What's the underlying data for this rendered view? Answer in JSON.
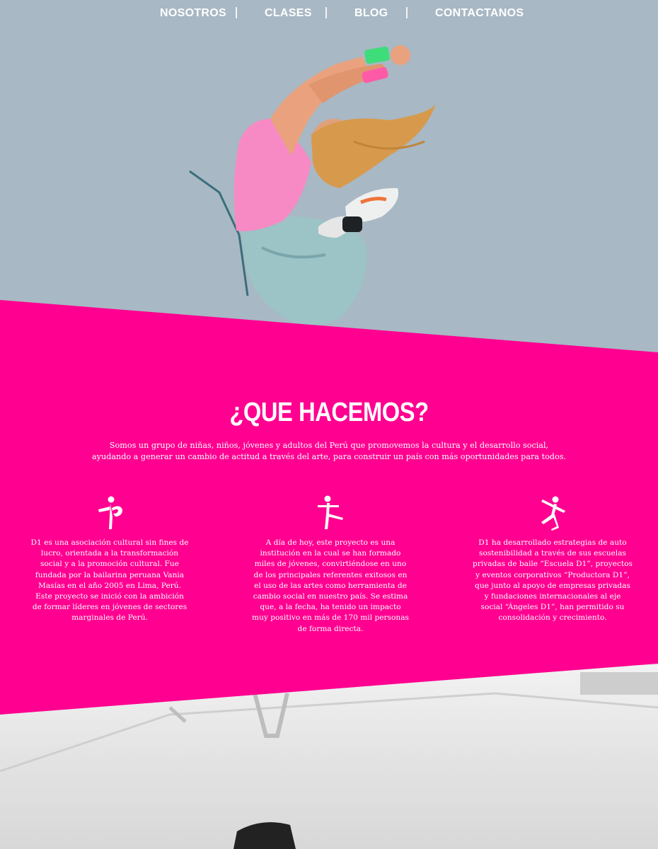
{
  "nav": {
    "items": [
      "NOSOTROS",
      "CLASES",
      "BLOG",
      "CONTACTANOS"
    ]
  },
  "colors": {
    "accent": "#ff0090",
    "hero_bg": "#a8b8c4",
    "text": "#ffffff"
  },
  "section": {
    "title": "¿QUE HACEMOS?",
    "intro": "Somos un grupo de niñas, niños, jóvenes y adultos del Perú que promovemos la cultura y el desarrollo social, ayudando a generar un cambio de actitud a través del arte, para construir un país con más oportunidades para todos."
  },
  "columns": [
    {
      "icon": "dancer-arabesque-icon",
      "text": "D1 es una asociación cultural sin fines de lucro, orientada a la transformación social y a la promoción cultural. Fue fundada por la bailarina peruana Vania Masías en el año 2005 en Lima, Perú. Este proyecto se inició con la ambición de formar líderes en jóvenes de sectores marginales de Perú."
    },
    {
      "icon": "dancer-leap-icon",
      "text": "A día de hoy, este proyecto es una institución en la cual se han formado miles de jóvenes, convirtiéndose en uno de los principales referentes exitosos en el uso de las artes como herramienta de cambio social en nuestro país. Se estima que, a la fecha, ha tenido un impacto muy positivo en más de 170 mil personas de forma directa."
    },
    {
      "icon": "dancer-jump-icon",
      "text": "D1 ha desarrollado estrategias de auto sostenibilidad a través de sus escuelas privadas de baile “Escuela D1”, proyectos y eventos corporativos “Productora D1”, que junto al apoyo de empresas privadas y fundaciones internacionales al eje social “Ángeles D1”, han permitido su consolidación y crecimiento."
    }
  ]
}
